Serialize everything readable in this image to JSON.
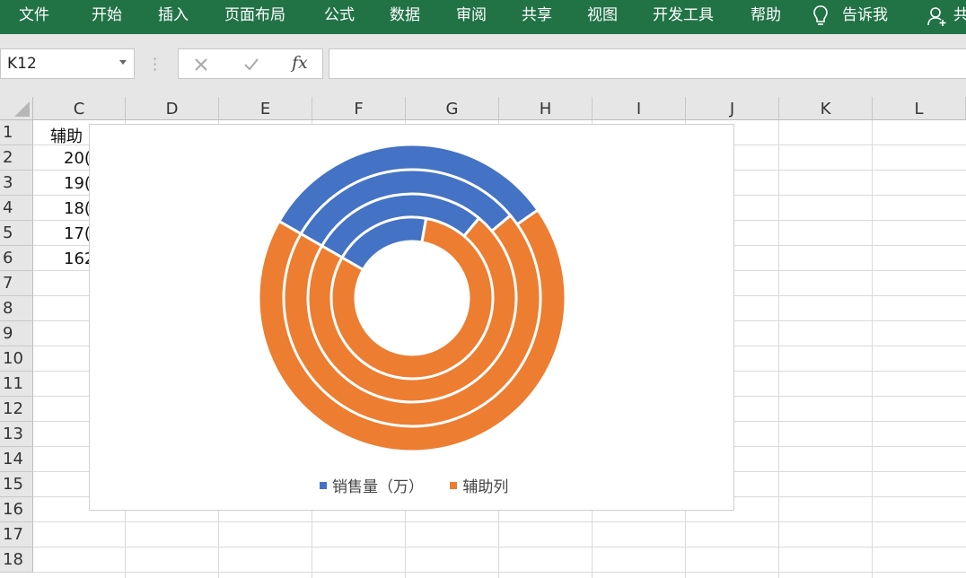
{
  "ribbon": {
    "tabs": [
      "文件",
      "开始",
      "插入",
      "页面布局",
      "公式",
      "数据",
      "审阅",
      "共享",
      "视图",
      "开发工具",
      "帮助"
    ],
    "tell_me": "告诉我",
    "share": "共",
    "bg_color": "#217346"
  },
  "formula_bar": {
    "name_box": "K12",
    "formula": ""
  },
  "grid": {
    "columns": [
      "C",
      "D",
      "E",
      "F",
      "G",
      "H",
      "I",
      "J",
      "K",
      "L"
    ],
    "rows": [
      "1",
      "2",
      "3",
      "4",
      "5",
      "6",
      "7",
      "8",
      "9",
      "10",
      "11",
      "12",
      "13",
      "14",
      "15",
      "16",
      "17",
      "18"
    ],
    "cells": {
      "C1": "辅助",
      "C2": "20(",
      "C3": "19(",
      "C4": "18(",
      "C5": "17(",
      "C6": "162"
    }
  },
  "chart_data": {
    "type": "doughnut",
    "legend": [
      "销售量（万）",
      "辅助列"
    ],
    "legend_position": "bottom",
    "colors": {
      "series1": "#4472C4",
      "series2": "#ED7D31"
    },
    "rings": [
      {
        "label": "outer",
        "series1_deg": 115,
        "series2_deg": 245
      },
      {
        "label": "ring2",
        "series1_deg": 110,
        "series2_deg": 250
      },
      {
        "label": "ring3",
        "series1_deg": 100,
        "series2_deg": 260
      },
      {
        "label": "inner",
        "series1_deg": 70,
        "series2_deg": 290
      }
    ]
  }
}
